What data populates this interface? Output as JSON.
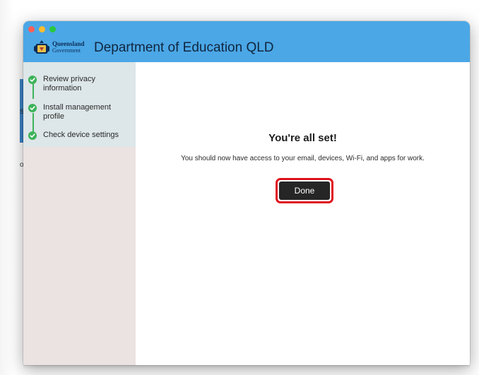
{
  "window": {
    "brand_line1": "Queensland",
    "brand_line2": "Government",
    "title": "Department of Education QLD",
    "titlebar_color": "#4ba7e6"
  },
  "background": {
    "fragment_a": "s",
    "fragment_b": "o"
  },
  "steps": [
    {
      "label": "Review privacy information",
      "status": "complete",
      "icon": "check-circle-icon"
    },
    {
      "label": "Install management profile",
      "status": "complete",
      "icon": "check-circle-icon"
    },
    {
      "label": "Check device settings",
      "status": "complete",
      "icon": "check-circle-icon"
    }
  ],
  "main": {
    "heading": "You're all set!",
    "message": "You should now have access to your email, devices, Wi-Fi, and apps for work.",
    "done_label": "Done"
  },
  "colors": {
    "accent_green": "#3db35a",
    "highlight_red": "#e0121c",
    "button_dark": "#262626"
  }
}
